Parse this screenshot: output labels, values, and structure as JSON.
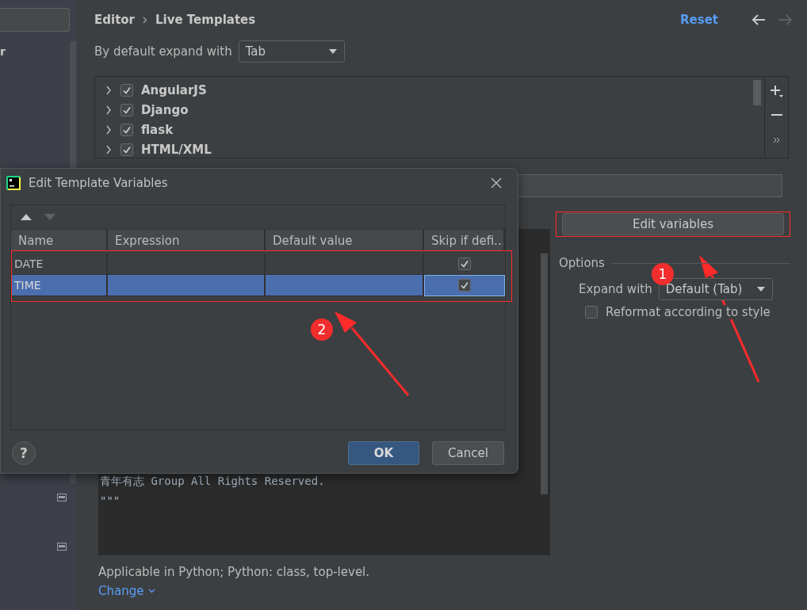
{
  "sidebar": {
    "item_text": "r"
  },
  "header": {
    "breadcrumb": [
      "Editor",
      "Live Templates"
    ],
    "reset_link": "Reset",
    "history": [
      {
        "kind": "back",
        "disabled": false
      },
      {
        "kind": "forward",
        "disabled": true
      }
    ]
  },
  "expand_default": {
    "label": "By default expand with",
    "value": "Tab"
  },
  "template_groups": [
    {
      "label": "AngularJS",
      "checked": true,
      "expanded": false
    },
    {
      "label": "Django",
      "checked": true,
      "expanded": false
    },
    {
      "label": "flask",
      "checked": true,
      "expanded": false
    },
    {
      "label": "HTML/XML",
      "checked": true,
      "expanded": false
    }
  ],
  "editor_lines": [
    "青年有志 Group All Rights Reserved.",
    "\"\"\""
  ],
  "edit_variables_button": {
    "label": "Edit variables"
  },
  "options": {
    "title": "Options",
    "expand_with": {
      "label": "Expand with",
      "value": "Default (Tab)"
    },
    "reformat": {
      "label": "Reformat according to style",
      "checked": false
    }
  },
  "applicable": "Applicable in Python; Python: class, top-level.",
  "change_link": "Change",
  "dialog": {
    "title": "Edit Template Variables",
    "columns": [
      "Name",
      "Expression",
      "Default value",
      "Skip if defi…"
    ],
    "rows": [
      {
        "name": "DATE",
        "skip": true,
        "selected": false
      },
      {
        "name": "TIME",
        "skip": true,
        "selected": true
      }
    ],
    "help_button": "?",
    "buttons": [
      {
        "label": "OK",
        "kind": "default"
      },
      {
        "label": "Cancel",
        "kind": "normal"
      }
    ]
  },
  "annotations": [
    {
      "label": "1"
    },
    {
      "label": "2"
    }
  ]
}
